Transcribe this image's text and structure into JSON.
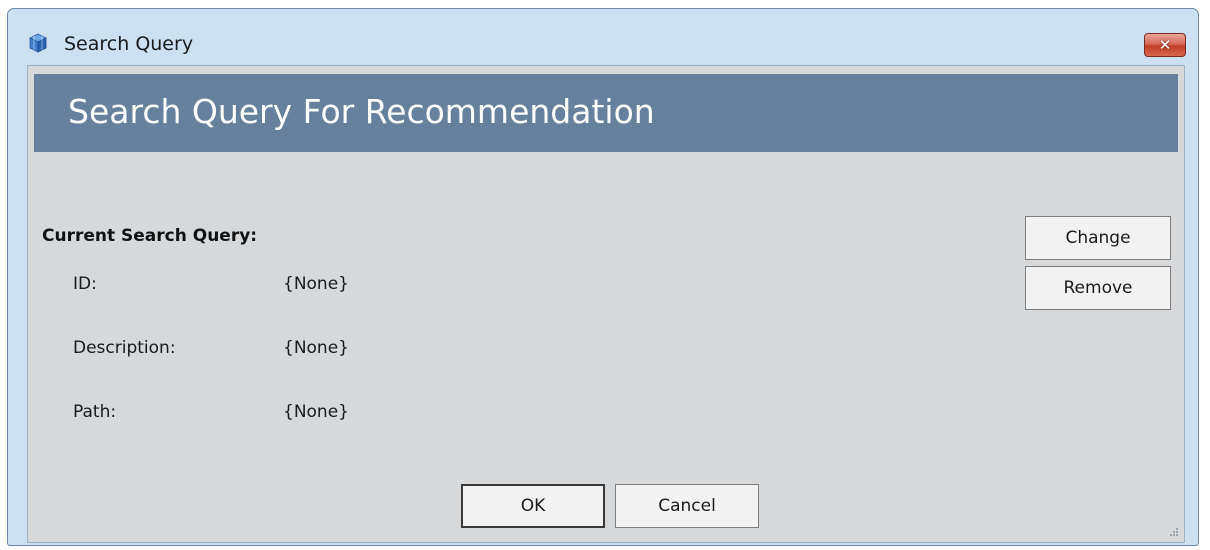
{
  "window": {
    "title": "Search Query",
    "close_label": "✕"
  },
  "banner": {
    "title": "Search Query For Recommendation"
  },
  "current_query": {
    "heading": "Current Search Query:",
    "fields": [
      {
        "label": "ID:",
        "value": "{None}"
      },
      {
        "label": "Description:",
        "value": "{None}"
      },
      {
        "label": "Path:",
        "value": "{None}"
      }
    ]
  },
  "actions": {
    "change_label": "Change",
    "remove_label": "Remove",
    "ok_label": "OK",
    "cancel_label": "Cancel"
  },
  "colors": {
    "banner": "#67809d",
    "client": "#d6d8da",
    "frame": "#cde0f2",
    "close": "#c13f28"
  }
}
